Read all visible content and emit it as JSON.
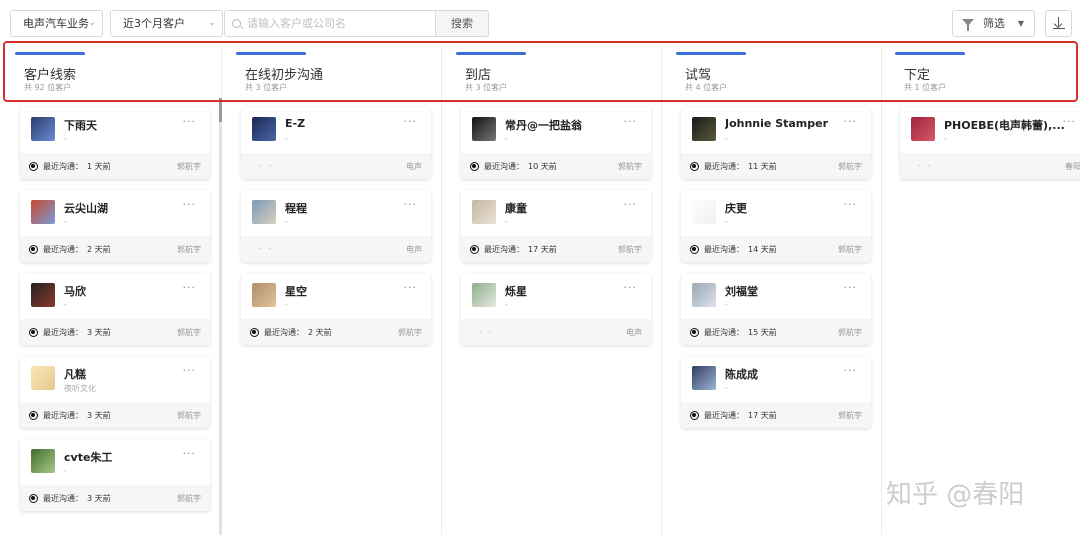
{
  "toolbar": {
    "dropdown_1": "电声汽车业务",
    "dropdown_2": "近3个月客户",
    "search_placeholder": "请输入客户或公司名",
    "search_button": "搜索",
    "filter_label": "筛选"
  },
  "columns": [
    {
      "title": "客户线索",
      "count": "共 92 位客户",
      "cards": [
        {
          "name": "下雨天",
          "sub": "-",
          "last_label": "最近沟通：",
          "last_value": "1 天前",
          "owner": "郭航宇"
        },
        {
          "name": "云尖山湖",
          "sub": "-",
          "last_label": "最近沟通：",
          "last_value": "2 天前",
          "owner": "郭航宇"
        },
        {
          "name": "马欣",
          "sub": "-",
          "last_label": "最近沟通：",
          "last_value": "3 天前",
          "owner": "郭航宇"
        },
        {
          "name": "凡糕",
          "sub": "夜听文化",
          "last_label": "最近沟通：",
          "last_value": "3 天前",
          "owner": "郭航宇"
        },
        {
          "name": "cvte朱工",
          "sub": "-",
          "last_label": "最近沟通：",
          "last_value": "3 天前",
          "owner": "郭航宇"
        }
      ]
    },
    {
      "title": "在线初步沟通",
      "count": "共 3 位客户",
      "cards": [
        {
          "name": "E-Z",
          "sub": "-",
          "dash": "- -",
          "owner": "电声"
        },
        {
          "name": "程程",
          "sub": "-",
          "dash": "- -",
          "owner": "电声"
        },
        {
          "name": "星空",
          "sub": "-",
          "last_label": "最近沟通：",
          "last_value": "2 天前",
          "owner": "郭航宇"
        }
      ]
    },
    {
      "title": "到店",
      "count": "共 3 位客户",
      "cards": [
        {
          "name": "常丹@一把盐翁",
          "sub": "-",
          "last_label": "最近沟通：",
          "last_value": "10 天前",
          "owner": "郭航宇"
        },
        {
          "name": "康童",
          "sub": "-",
          "last_label": "最近沟通：",
          "last_value": "17 天前",
          "owner": "郭航宇"
        },
        {
          "name": "烁星",
          "sub": "-",
          "dash": "- -",
          "owner": "电声"
        }
      ]
    },
    {
      "title": "试驾",
      "count": "共 4 位客户",
      "cards": [
        {
          "name": "Johnnie Stamper",
          "sub": "-",
          "last_label": "最近沟通：",
          "last_value": "11 天前",
          "owner": "郭航宇"
        },
        {
          "name": "庆更",
          "sub": "-",
          "last_label": "最近沟通：",
          "last_value": "14 天前",
          "owner": "郭航宇"
        },
        {
          "name": "刘福堂",
          "sub": "-",
          "last_label": "最近沟通：",
          "last_value": "15 天前",
          "owner": "郭航宇"
        },
        {
          "name": "陈成成",
          "sub": "-",
          "last_label": "最近沟通：",
          "last_value": "17 天前",
          "owner": "郭航宇"
        }
      ]
    },
    {
      "title": "下定",
      "count": "共 1 位客户",
      "cards": [
        {
          "name": "PHOEBE(电声韩蕾),...",
          "sub": "-",
          "dash": "- -",
          "owner": "春阳"
        }
      ]
    }
  ],
  "more_glyph": "···",
  "watermark": "知乎 @春阳",
  "colors": {
    "accent": "#3a6fd8",
    "highlight": "#d8302a"
  }
}
